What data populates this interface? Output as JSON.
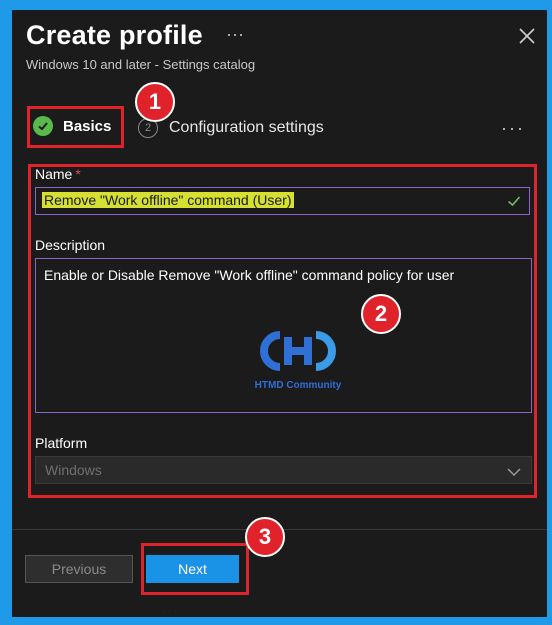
{
  "header": {
    "title": "Create profile",
    "more": "···",
    "subtitle": "Windows 10 and later - Settings catalog"
  },
  "tabs": [
    {
      "label": "Basics",
      "state": "complete",
      "icon": "check-icon"
    },
    {
      "label": "Configuration settings",
      "step": "2"
    }
  ],
  "tabs_more": "···",
  "form": {
    "name": {
      "label": "Name",
      "required_mark": "*",
      "value": "Remove \"Work offline\" command (User)"
    },
    "description": {
      "label": "Description",
      "value": "Enable or Disable Remove \"Work offline\" command policy for user"
    },
    "platform": {
      "label": "Platform",
      "value": "Windows"
    }
  },
  "watermark": {
    "text": "HTMD Community"
  },
  "footer": {
    "previous_label": "Previous",
    "next_label": "Next",
    "faint_text": "· · ·"
  },
  "annotations": [
    "1",
    "2",
    "3"
  ],
  "colors": {
    "accent": "#1a92e6",
    "highlight": "#e0222a",
    "success": "#5bb84d",
    "name_highlight": "#d6e032"
  }
}
